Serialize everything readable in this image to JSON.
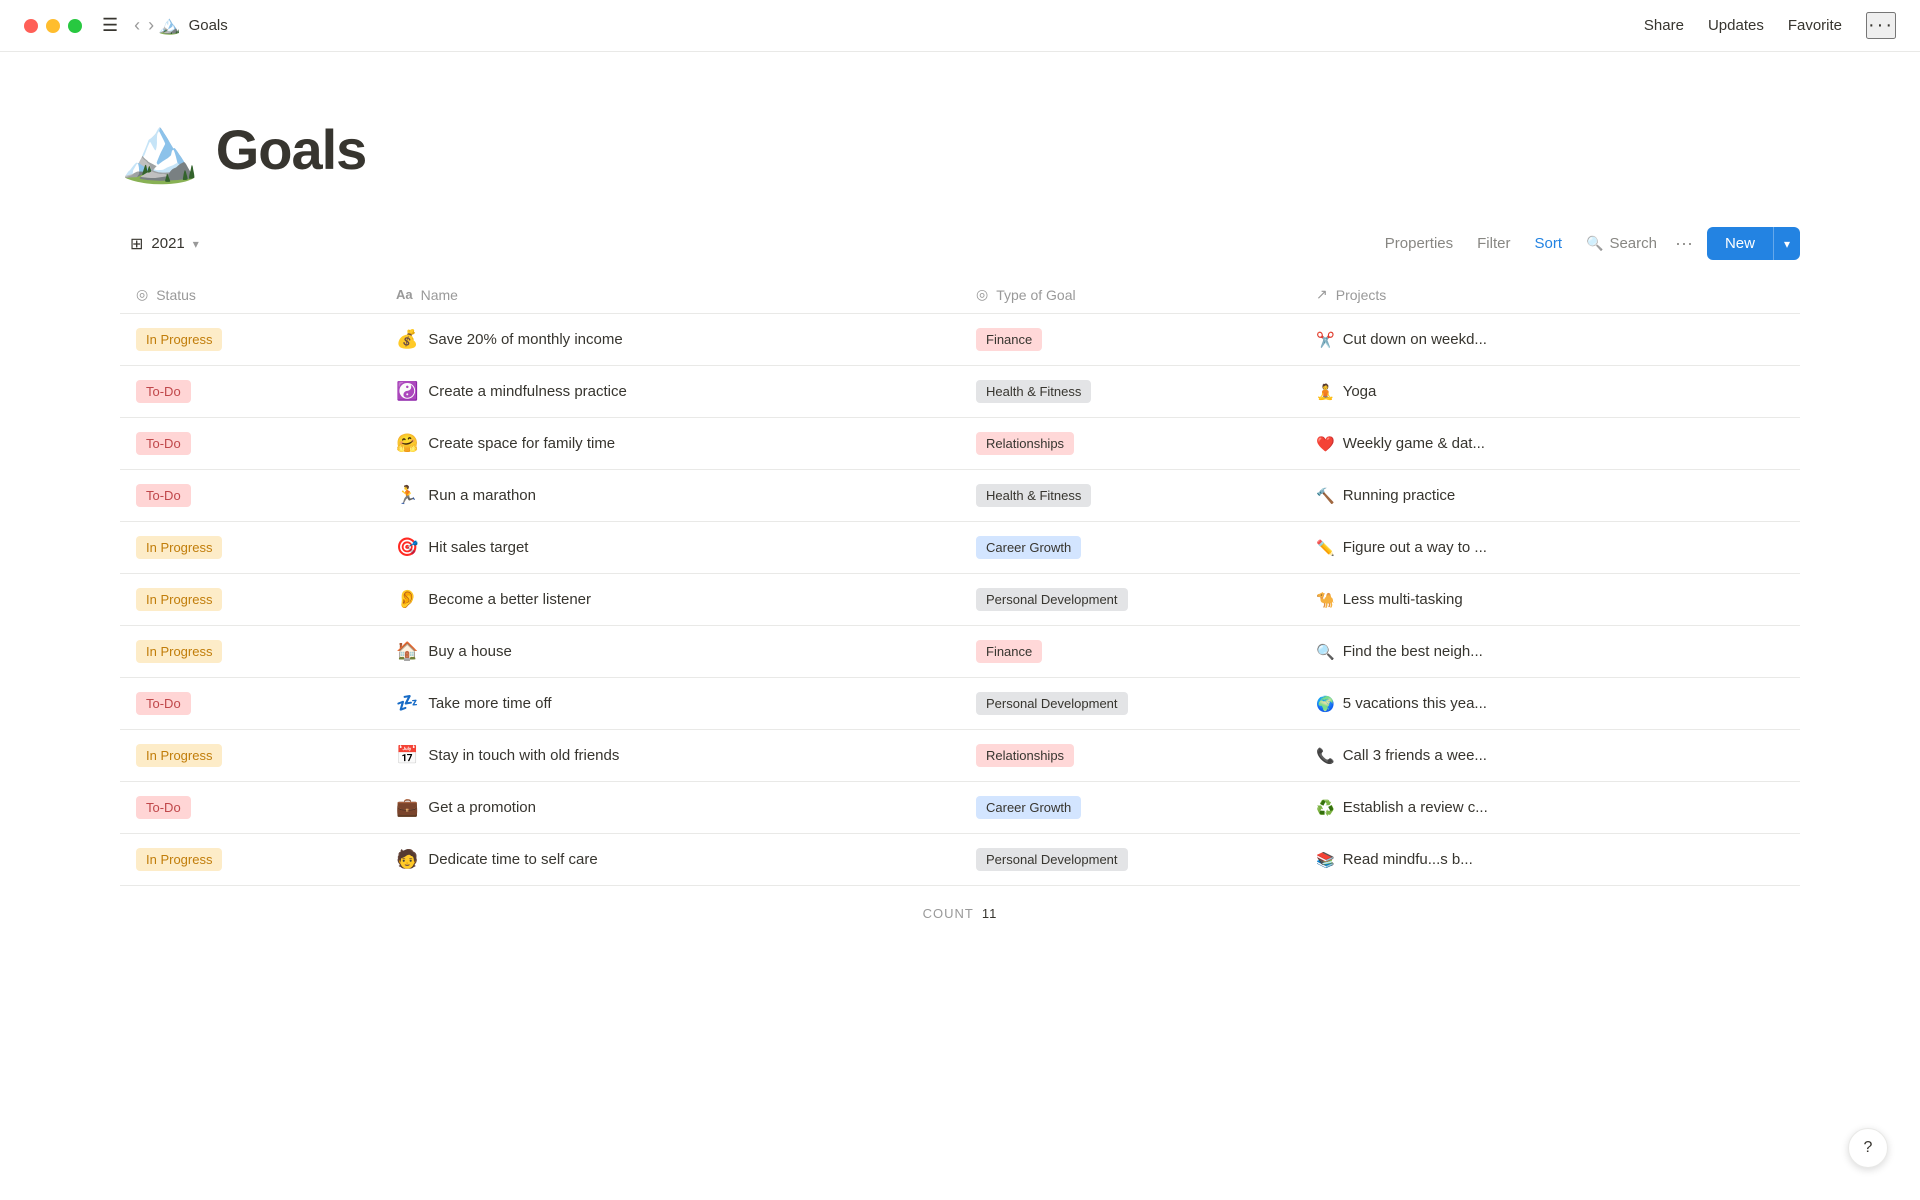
{
  "titlebar": {
    "page_icon": "🏔️",
    "page_title": "Goals",
    "share_label": "Share",
    "updates_label": "Updates",
    "favorite_label": "Favorite",
    "more_dots": "···"
  },
  "header": {
    "icon": "🏔️",
    "title": "Goals"
  },
  "toolbar": {
    "view_icon": "⊞",
    "view_label": "2021",
    "properties_label": "Properties",
    "filter_label": "Filter",
    "sort_label": "Sort",
    "search_label": "Search",
    "new_label": "New"
  },
  "columns": [
    {
      "icon": "◎",
      "label": "Status"
    },
    {
      "icon": "Aa",
      "label": "Name"
    },
    {
      "icon": "◎",
      "label": "Type of Goal"
    },
    {
      "icon": "↗",
      "label": "Projects"
    }
  ],
  "rows": [
    {
      "status": "In Progress",
      "status_type": "in-progress",
      "emoji": "💰",
      "name": "Save 20% of monthly income",
      "goal_type": "Finance",
      "goal_type_class": "type-finance",
      "project_emoji": "✂️",
      "project": "Cut down on weekd..."
    },
    {
      "status": "To-Do",
      "status_type": "todo",
      "emoji": "☯️",
      "name": "Create a mindfulness practice",
      "goal_type": "Health & Fitness",
      "goal_type_class": "type-health",
      "project_emoji": "🧘",
      "project": "Yoga"
    },
    {
      "status": "To-Do",
      "status_type": "todo",
      "emoji": "🤗",
      "name": "Create space for family time",
      "goal_type": "Relationships",
      "goal_type_class": "type-relationships",
      "project_emoji": "❤️",
      "project": "Weekly game & dat..."
    },
    {
      "status": "To-Do",
      "status_type": "todo",
      "emoji": "🏃",
      "name": "Run a marathon",
      "goal_type": "Health & Fitness",
      "goal_type_class": "type-health",
      "project_emoji": "🔨",
      "project": "Running practice"
    },
    {
      "status": "In Progress",
      "status_type": "in-progress",
      "emoji": "🎯",
      "name": "Hit sales target",
      "goal_type": "Career Growth",
      "goal_type_class": "type-career",
      "project_emoji": "✏️",
      "project": "Figure out a way to ..."
    },
    {
      "status": "In Progress",
      "status_type": "in-progress",
      "emoji": "👂",
      "name": "Become a better listener",
      "goal_type": "Personal Development",
      "goal_type_class": "type-personal",
      "project_emoji": "🐪",
      "project": "Less multi-tasking"
    },
    {
      "status": "In Progress",
      "status_type": "in-progress",
      "emoji": "🏠",
      "name": "Buy a house",
      "goal_type": "Finance",
      "goal_type_class": "type-finance",
      "project_emoji": "🔍",
      "project": "Find the best neigh..."
    },
    {
      "status": "To-Do",
      "status_type": "todo",
      "emoji": "💤",
      "name": "Take more time off",
      "goal_type": "Personal Development",
      "goal_type_class": "type-personal",
      "project_emoji": "🌍",
      "project": "5 vacations this yea..."
    },
    {
      "status": "In Progress",
      "status_type": "in-progress",
      "emoji": "📅",
      "name": "Stay in touch with old friends",
      "goal_type": "Relationships",
      "goal_type_class": "type-relationships",
      "project_emoji": "📞",
      "project": "Call 3 friends a wee..."
    },
    {
      "status": "To-Do",
      "status_type": "todo",
      "emoji": "💼",
      "name": "Get a promotion",
      "goal_type": "Career Growth",
      "goal_type_class": "type-career",
      "project_emoji": "♻️",
      "project": "Establish a review c..."
    },
    {
      "status": "In Progress",
      "status_type": "in-progress",
      "emoji": "🧑",
      "name": "Dedicate time to self care",
      "goal_type": "Personal Development",
      "goal_type_class": "type-personal",
      "project_emoji": "📚",
      "project": "Read mindfu...s b..."
    }
  ],
  "count": {
    "label": "COUNT",
    "value": "11"
  },
  "help": "?"
}
